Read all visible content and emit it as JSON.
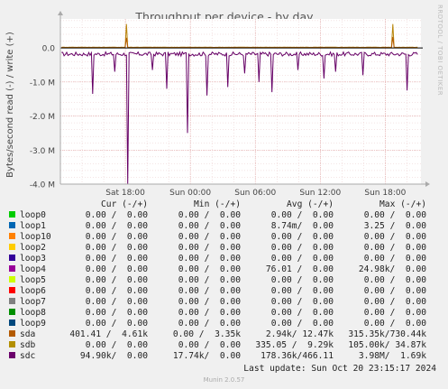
{
  "chart_data": {
    "type": "line",
    "title": "Throughput per device - by day",
    "ylabel": "Bytes/second read (-) / write (+)",
    "ylim": [
      -4000000,
      850000
    ],
    "y_ticks": [
      {
        "value": 0,
        "label": "0.0"
      },
      {
        "value": -1000000,
        "label": "-1.0 M"
      },
      {
        "value": -2000000,
        "label": "-2.0 M"
      },
      {
        "value": -3000000,
        "label": "-3.0 M"
      },
      {
        "value": -4000000,
        "label": "-4.0 M"
      }
    ],
    "x_ticks": [
      {
        "value": 6,
        "label": "Sat 18:00"
      },
      {
        "value": 12,
        "label": "Sun 00:00"
      },
      {
        "value": 18,
        "label": "Sun 06:00"
      },
      {
        "value": 24,
        "label": "Sun 12:00"
      },
      {
        "value": 30,
        "label": "Sun 18:00"
      }
    ],
    "xlim": [
      0,
      33.3
    ],
    "grid": true,
    "series": [
      {
        "name": "sdc",
        "color": "#660066",
        "direction": "read",
        "baseline": -180000,
        "spikes": [
          [
            3.0,
            -1350000
          ],
          [
            5.0,
            -700000
          ],
          [
            6.2,
            -4000000
          ],
          [
            8.5,
            -650000
          ],
          [
            9.8,
            -1200000
          ],
          [
            11.7,
            -2500000
          ],
          [
            13.5,
            -1400000
          ],
          [
            15.5,
            -1150000
          ],
          [
            17.0,
            -750000
          ],
          [
            18.3,
            -1000000
          ],
          [
            19.5,
            -1300000
          ],
          [
            22.0,
            -650000
          ],
          [
            24.4,
            -900000
          ],
          [
            25.4,
            -700000
          ],
          [
            28.0,
            -800000
          ],
          [
            32.0,
            -1250000
          ]
        ]
      },
      {
        "name": "sdb",
        "color": "#b8860b",
        "direction": "write",
        "baseline": 15000,
        "spikes": [
          [
            6.15,
            700000
          ],
          [
            30.75,
            700000
          ]
        ]
      },
      {
        "name": "sda",
        "color": "#b35900",
        "direction": "write",
        "baseline": 5000,
        "spikes": [
          [
            6.15,
            300000
          ],
          [
            30.75,
            320000
          ]
        ]
      }
    ]
  },
  "legend": {
    "headers": {
      "cur": "Cur (-/+)",
      "min": "Min (-/+)",
      "avg": "Avg (-/+)",
      "max": "Max (-/+)"
    },
    "rows": [
      {
        "name": "loop0",
        "color": "#00cc00",
        "cur": "0.00 /  0.00",
        "min": "0.00 /  0.00",
        "avg": "0.00 /  0.00",
        "max": "0.00 /  0.00"
      },
      {
        "name": "loop1",
        "color": "#0066b3",
        "cur": "0.00 /  0.00",
        "min": "0.00 /  0.00",
        "avg": "8.74m/  0.00",
        "max": "3.25 /  0.00"
      },
      {
        "name": "loop10",
        "color": "#ff8000",
        "cur": "0.00 /  0.00",
        "min": "0.00 /  0.00",
        "avg": "0.00 /  0.00",
        "max": "0.00 /  0.00"
      },
      {
        "name": "loop2",
        "color": "#ffcc00",
        "cur": "0.00 /  0.00",
        "min": "0.00 /  0.00",
        "avg": "0.00 /  0.00",
        "max": "0.00 /  0.00"
      },
      {
        "name": "loop3",
        "color": "#330099",
        "cur": "0.00 /  0.00",
        "min": "0.00 /  0.00",
        "avg": "0.00 /  0.00",
        "max": "0.00 /  0.00"
      },
      {
        "name": "loop4",
        "color": "#990099",
        "cur": "0.00 /  0.00",
        "min": "0.00 /  0.00",
        "avg": "76.01 /  0.00",
        "max": "24.98k/  0.00"
      },
      {
        "name": "loop5",
        "color": "#ccff00",
        "cur": "0.00 /  0.00",
        "min": "0.00 /  0.00",
        "avg": "0.00 /  0.00",
        "max": "0.00 /  0.00"
      },
      {
        "name": "loop6",
        "color": "#ff0000",
        "cur": "0.00 /  0.00",
        "min": "0.00 /  0.00",
        "avg": "0.00 /  0.00",
        "max": "0.00 /  0.00"
      },
      {
        "name": "loop7",
        "color": "#808080",
        "cur": "0.00 /  0.00",
        "min": "0.00 /  0.00",
        "avg": "0.00 /  0.00",
        "max": "0.00 /  0.00"
      },
      {
        "name": "loop8",
        "color": "#008f00",
        "cur": "0.00 /  0.00",
        "min": "0.00 /  0.00",
        "avg": "0.00 /  0.00",
        "max": "0.00 /  0.00"
      },
      {
        "name": "loop9",
        "color": "#00487d",
        "cur": "0.00 /  0.00",
        "min": "0.00 /  0.00",
        "avg": "0.00 /  0.00",
        "max": "0.00 /  0.00"
      },
      {
        "name": "sda",
        "color": "#b35a00",
        "cur": "401.41 /  4.61k",
        "min": "0.00 /  3.35k",
        "avg": "2.94k/ 12.47k",
        "max": "315.35k/730.44k"
      },
      {
        "name": "sdb",
        "color": "#b38f00",
        "cur": "0.00 /  0.00",
        "min": "0.00 /  0.00",
        "avg": "335.05 /  9.29k",
        "max": "105.00k/ 34.87k"
      },
      {
        "name": "sdc",
        "color": "#6b006b",
        "cur": "94.90k/  0.00",
        "min": "17.74k/  0.00",
        "avg": "178.36k/466.11",
        "max": "3.98M/  1.69k"
      }
    ]
  },
  "footer": {
    "last_update": "Last update: Sun Oct 20 23:15:17 2024",
    "generator": "Munin 2.0.57",
    "watermark": "RRDTOOL / TOBI OETIKER"
  }
}
